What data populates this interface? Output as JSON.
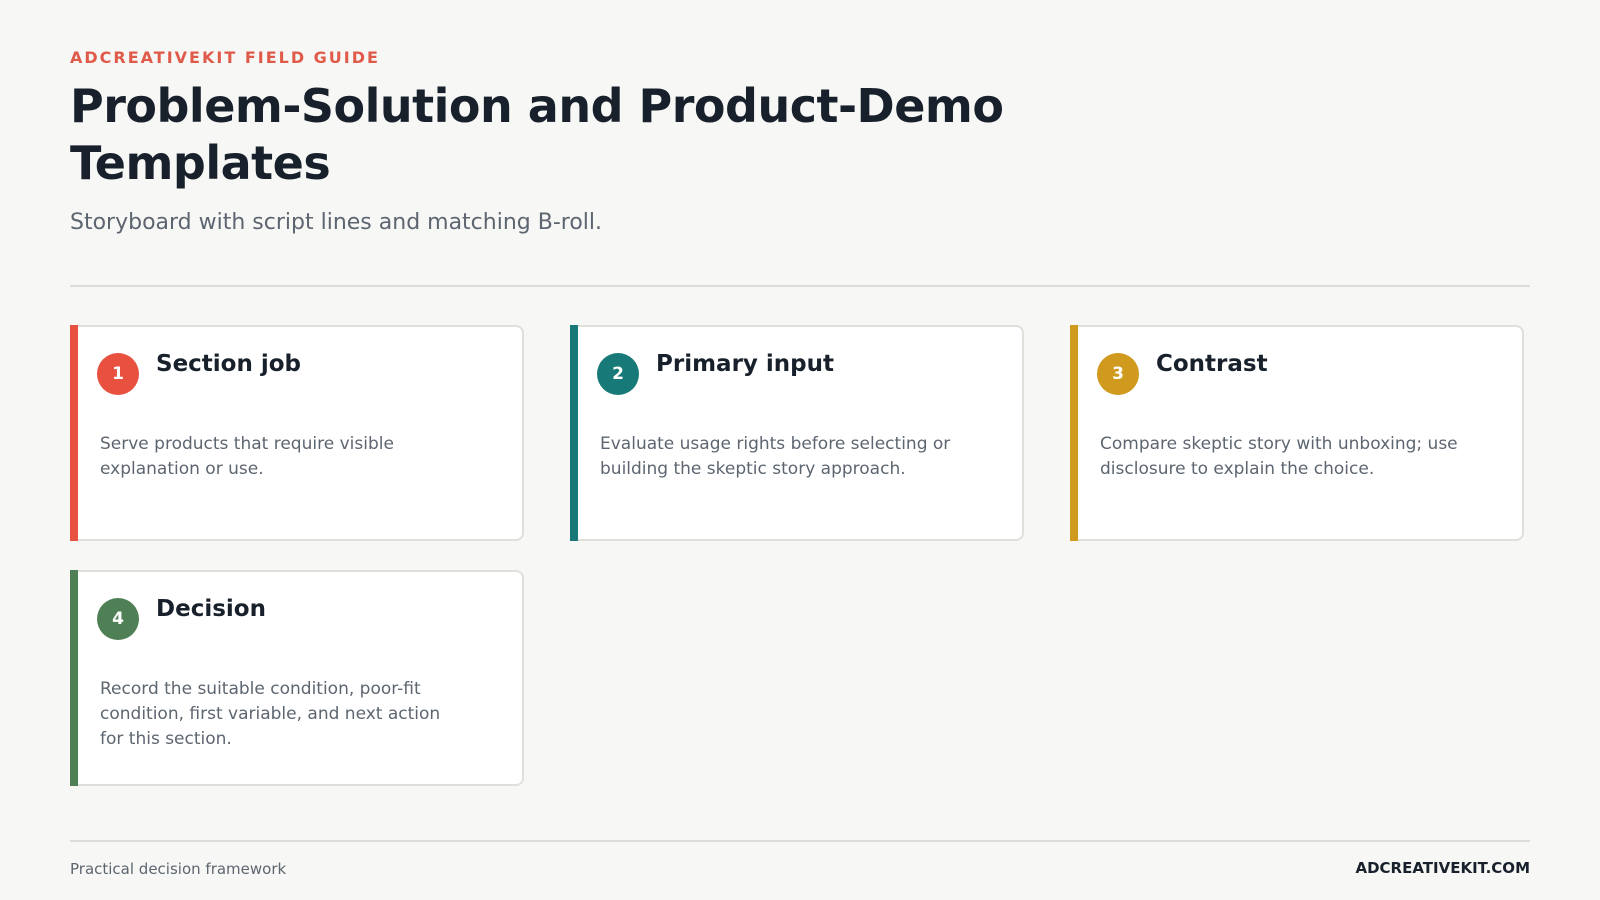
{
  "header": {
    "eyebrow": "ADCREATIVEKIT FIELD GUIDE",
    "title": "Problem-Solution and Product-Demo Templates",
    "subtitle": "Storyboard with script lines and matching B-roll."
  },
  "cards": [
    {
      "number": "1",
      "title": "Section job",
      "body": "Serve products that require visible explanation or use.",
      "color": "#e8503f"
    },
    {
      "number": "2",
      "title": "Primary input",
      "body": "Evaluate usage rights before selecting or building the skeptic story approach.",
      "color": "#177a78"
    },
    {
      "number": "3",
      "title": "Contrast",
      "body": "Compare skeptic story with unboxing; use disclosure to explain the choice.",
      "color": "#d09a1e"
    },
    {
      "number": "4",
      "title": "Decision",
      "body": "Record the suitable condition, poor-fit condition, first variable, and next action for this section.",
      "color": "#4f7f55"
    }
  ],
  "footer": {
    "left": "Practical decision framework",
    "right": "ADCREATIVEKIT.COM"
  }
}
